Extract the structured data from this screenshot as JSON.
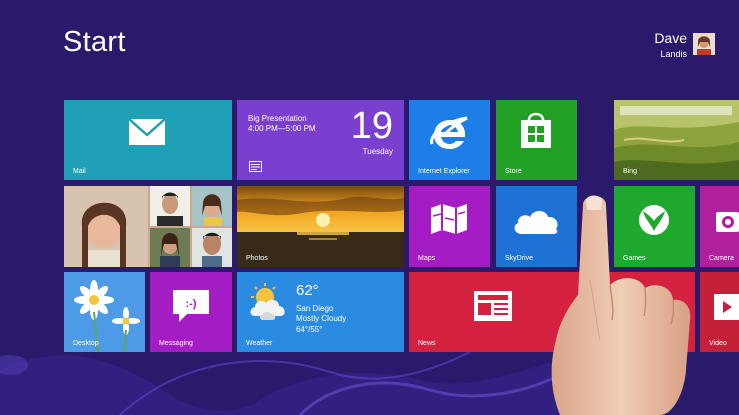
{
  "start_title": "Start",
  "user": {
    "first_name": "Dave",
    "last_name": "Landis"
  },
  "tiles": {
    "mail": {
      "label": "Mail",
      "color": "#1fa0b6"
    },
    "calendar": {
      "color": "#7b3fcf",
      "event_title": "Big Presentation",
      "event_time": "4:00 PM—5:00 PM",
      "day": "19",
      "weekday": "Tuesday"
    },
    "ie": {
      "label": "Internet Explorer",
      "color": "#1e7ee8"
    },
    "store": {
      "label": "Store",
      "color": "#22a024"
    },
    "bing": {
      "label": "Bing"
    },
    "people": {
      "label": ""
    },
    "photos": {
      "label": "Photos"
    },
    "maps": {
      "label": "Maps",
      "color": "#a41dc4"
    },
    "skydrive": {
      "label": "SkyDrive",
      "color": "#1e72d6"
    },
    "games": {
      "label": "Games",
      "color": "#1ea82e"
    },
    "camera": {
      "label": "Camera",
      "color": "#b0209c"
    },
    "desktop": {
      "label": "Desktop",
      "color": "#3d8fe0"
    },
    "messaging": {
      "label": "Messaging",
      "color": "#a41dc4"
    },
    "weather": {
      "label": "Weather",
      "color": "#2b8be0",
      "temp": "62°",
      "city": "San Diego",
      "condition": "Mostly Cloudy",
      "range": "64°/55°"
    },
    "news": {
      "label": "News",
      "color": "#d42140"
    },
    "video": {
      "label": "Video",
      "color": "#c4203a"
    }
  }
}
